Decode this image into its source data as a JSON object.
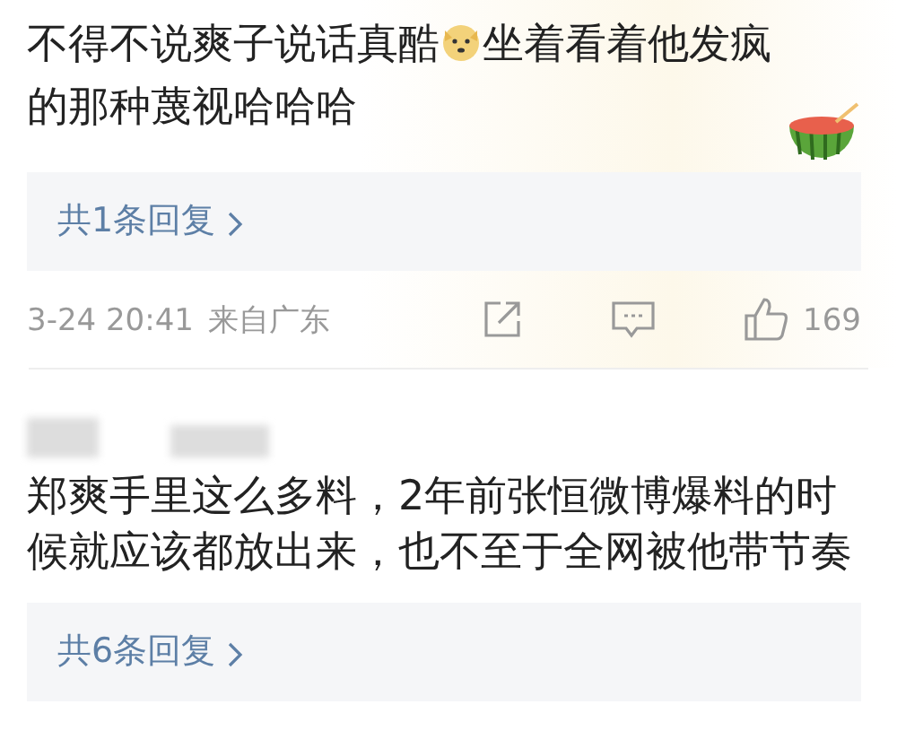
{
  "comments": [
    {
      "text_before_emoji": "不得不说爽子说话真酷",
      "text_after_emoji": "坐着看着他发疯",
      "text_line_2": "的那种蔑视哈哈哈",
      "sticker": true,
      "replies": "共1条回复",
      "time": "3-24 20:41",
      "location": "来自广东",
      "likes": "169"
    },
    {
      "text": "郑爽手里这么多料，2年前张恒微博爆料的时候就应该都放出来，也不至于全网被他带节奏",
      "username_hidden": true,
      "replies": "共6条回复"
    }
  ]
}
